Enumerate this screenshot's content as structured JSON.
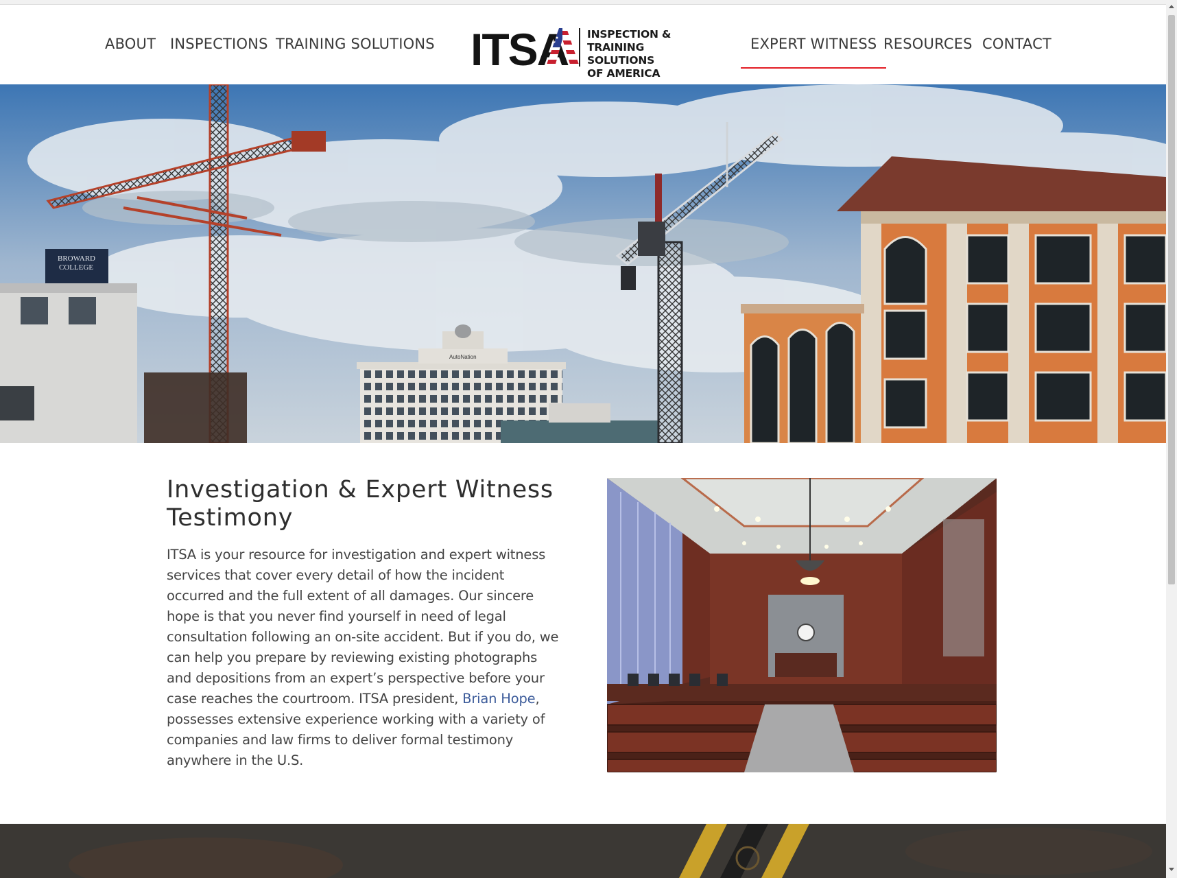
{
  "nav": {
    "left": [
      {
        "label": "ABOUT"
      },
      {
        "label": "INSPECTIONS"
      },
      {
        "label": "TRAINING SOLUTIONS"
      }
    ],
    "right": [
      {
        "label": "EXPERT WITNESS",
        "active": true
      },
      {
        "label": "RESOURCES"
      },
      {
        "label": "CONTACT"
      }
    ]
  },
  "logo": {
    "letters": "ITSA",
    "line1": "INSPECTION &",
    "line2": "TRAINING SOLUTIONS",
    "line3": "OF AMERICA"
  },
  "hero": {
    "college_sign_1": "BROWARD",
    "college_sign_2": "COLLEGE",
    "tower_sign": "AutoNation"
  },
  "content": {
    "title": "Investigation & Expert Witness Testimony",
    "body_before_link": "ITSA is your resource for investigation and expert witness services that cover every detail of how the incident occurred and the full extent of all damages. Our sincere hope is that you never find yourself in need of legal consultation following an on-site accident. But if you do, we can help you prepare by reviewing existing photographs and depositions from an expert’s perspective before your case reaches the courtroom. ITSA president, ",
    "link_text": "Brian Hope",
    "body_after_link": ", possesses extensive experience working with a variety of companies and law firms to deliver formal testimony anywhere in the U.S."
  },
  "colors": {
    "accent": "#e21b23",
    "link": "#3c5b9a",
    "text": "#444444",
    "band": "#3b3834"
  },
  "icons": {
    "scroll_up": "triangle-up",
    "scroll_down": "triangle-down"
  }
}
